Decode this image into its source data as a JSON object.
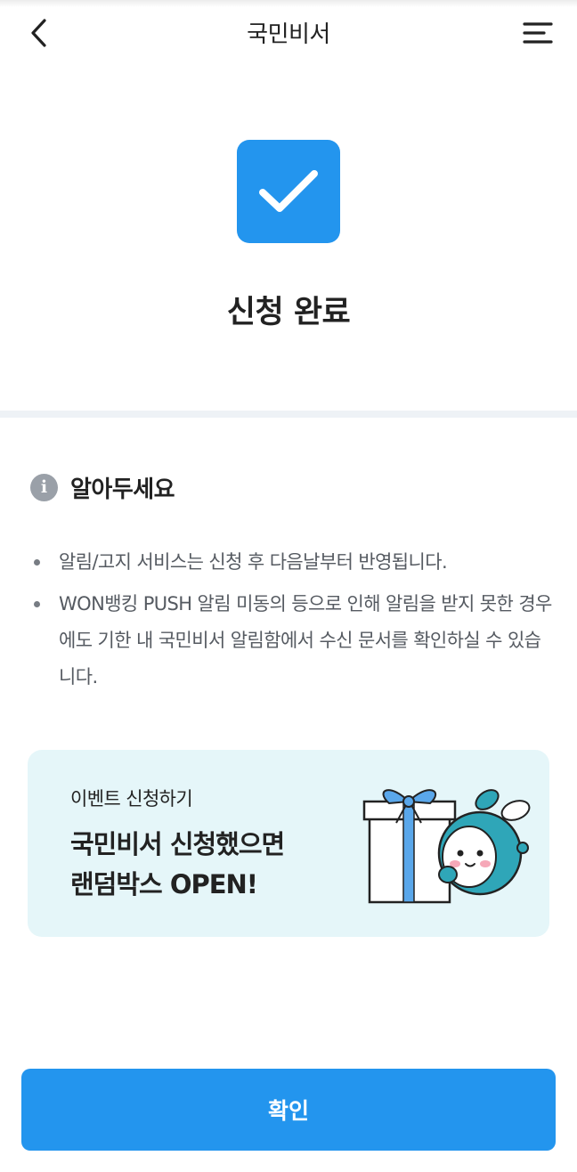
{
  "header": {
    "title": "국민비서",
    "back_icon": "chevron-left-icon",
    "menu_icon": "hamburger-menu-icon"
  },
  "status": {
    "icon": "checkmark-icon",
    "title": "신청 완료",
    "accent_color": "#2395ee"
  },
  "notice": {
    "icon": "info-icon",
    "title": "알아두세요",
    "items": [
      "알림/고지 서비스는 신청 후 다음날부터 반영됩니다.",
      "WON뱅킹 PUSH 알림 미동의 등으로 인해 알림을 받지 못한 경우에도 기한 내 국민비서 알림함에서 수신 문서를 확인하실 수 있습니다."
    ]
  },
  "banner": {
    "subtitle": "이벤트 신청하기",
    "title_line1": "국민비서 신청했으면",
    "title_line2": "랜덤박스 OPEN!",
    "illustration": "gift-box-mascot-illustration",
    "background_color": "#e5f6f9"
  },
  "footer": {
    "confirm_label": "확인"
  }
}
